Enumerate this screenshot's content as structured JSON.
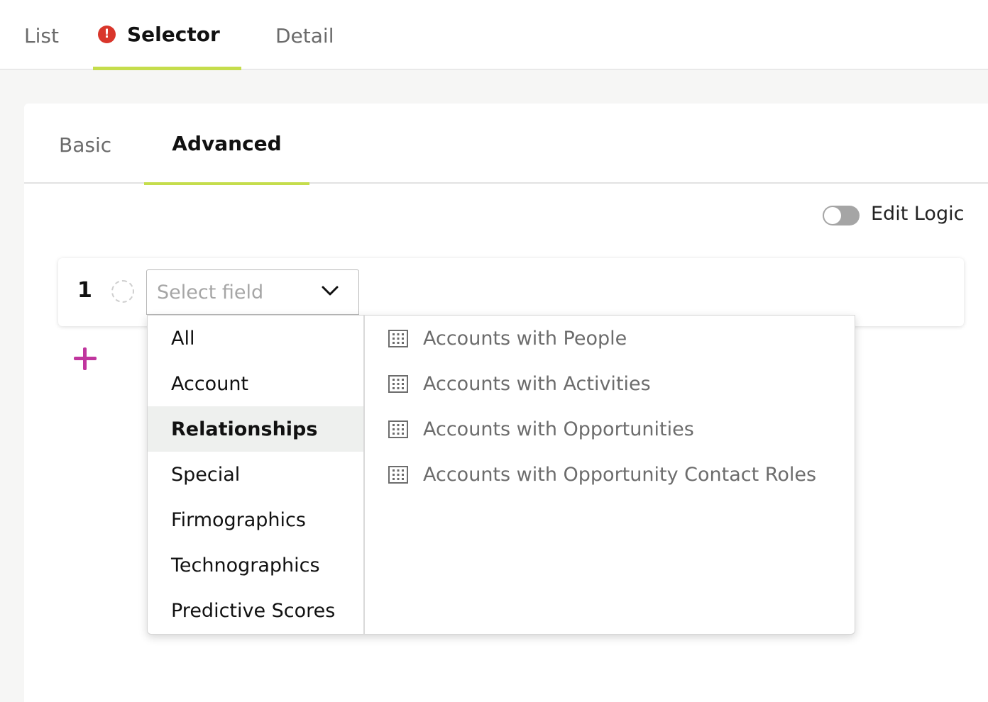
{
  "top_tabs": {
    "list": "List",
    "selector": "Selector",
    "selector_alert": "!",
    "detail": "Detail",
    "active": "Selector",
    "accent_color": "#c5dd4c",
    "alert_color": "#d9362b"
  },
  "sub_tabs": {
    "basic": "Basic",
    "advanced": "Advanced",
    "active": "Advanced"
  },
  "edit_logic": {
    "label": "Edit Logic",
    "enabled": false
  },
  "rule": {
    "number": "1",
    "select_placeholder": "Select field"
  },
  "add_button": {
    "icon": "plus-icon",
    "color": "#c0359e"
  },
  "dropdown": {
    "categories": [
      "All",
      "Account",
      "Relationships",
      "Special",
      "Firmographics",
      "Technographics",
      "Predictive Scores"
    ],
    "selected_category": "Relationships",
    "options": [
      {
        "icon": "building-icon",
        "label": "Accounts with People"
      },
      {
        "icon": "building-icon",
        "label": "Accounts with Activities"
      },
      {
        "icon": "building-icon",
        "label": "Accounts with Opportunities"
      },
      {
        "icon": "building-icon",
        "label": "Accounts with Opportunity Contact Roles"
      }
    ]
  }
}
